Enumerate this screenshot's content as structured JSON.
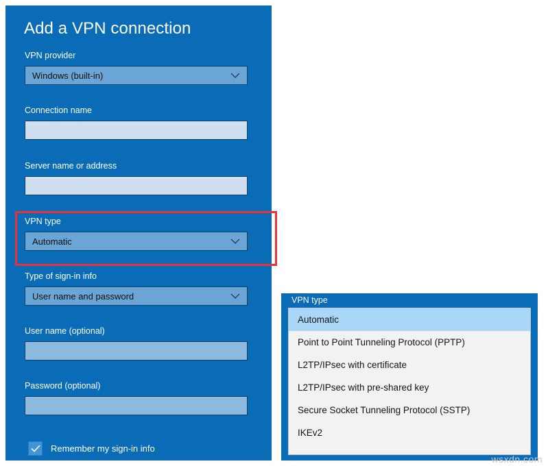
{
  "form": {
    "title": "Add a VPN connection",
    "fields": [
      {
        "label": "VPN provider",
        "type": "combo",
        "value": "Windows (built-in)",
        "icon": "chevron-down-icon"
      },
      {
        "label": "Connection name",
        "type": "text",
        "value": "",
        "placeholder": ""
      },
      {
        "label": "Server name or address",
        "type": "text",
        "value": "",
        "placeholder": ""
      },
      {
        "label": "VPN type",
        "type": "combo",
        "value": "Automatic",
        "icon": "chevron-down-icon"
      },
      {
        "label": "Type of sign-in info",
        "type": "combo",
        "value": "User name and password",
        "icon": "chevron-down-icon"
      },
      {
        "label": "User name (optional)",
        "type": "text",
        "value": "",
        "placeholder": ""
      },
      {
        "label": "Password (optional)",
        "type": "text",
        "value": "",
        "placeholder": ""
      }
    ],
    "remember": {
      "label": "Remember my sign-in info",
      "checked": true,
      "icon": "checkmark-icon"
    }
  },
  "dropdown": {
    "header": "VPN type",
    "selected": "Automatic",
    "options": [
      "Automatic",
      "Point to Point Tunneling Protocol (PPTP)",
      "L2TP/IPsec with certificate",
      "L2TP/IPsec with pre-shared key",
      "Secure Socket Tunneling Protocol (SSTP)",
      "IKEv2"
    ]
  },
  "annotation": {
    "target": "VPN type",
    "color": "#ed3237"
  },
  "watermark": "wsxdn.com",
  "colors": {
    "panel_blue": "#0a6cb6",
    "combo_fill": "#6aa5d6",
    "textbox_fill": "#cfdff0",
    "textbox_fill_tinted": "#8fbadf",
    "selection_blue": "#aad7f7",
    "checkbox_blue": "#3f95d8",
    "highlight_red": "#ed3237"
  }
}
